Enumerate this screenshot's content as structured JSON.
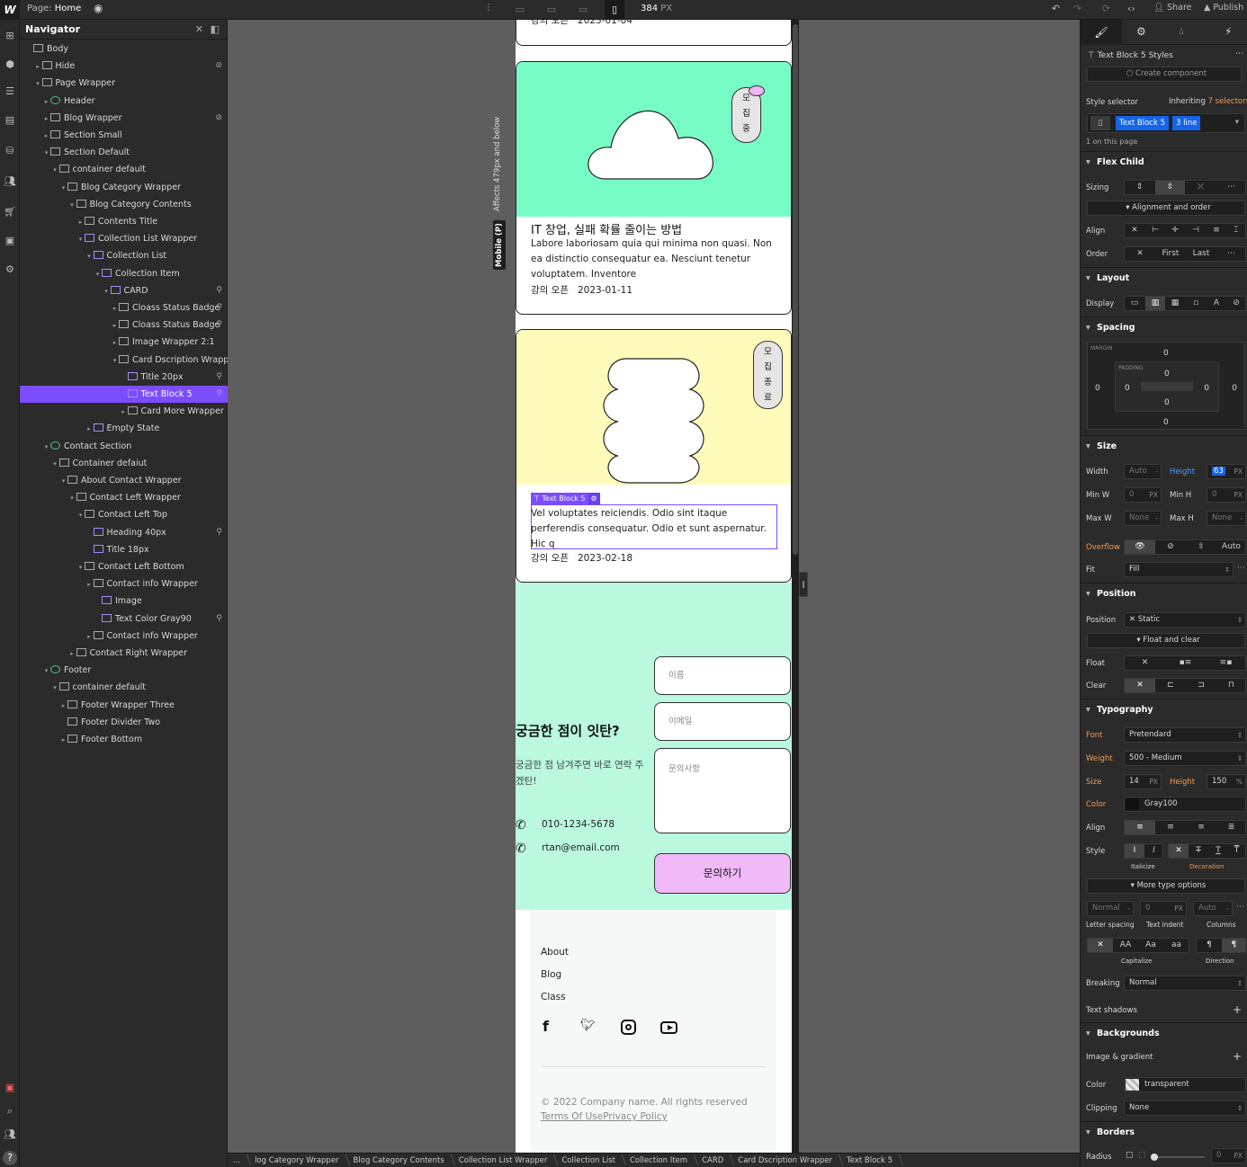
{
  "topbar": {
    "page_label": "Page:",
    "page_name": "Home",
    "width_value": "384",
    "width_unit": "PX",
    "share_label": "Share",
    "publish_label": "Publish"
  },
  "navigator": {
    "title": "Navigator",
    "items": [
      {
        "label": "Body",
        "depth": 0
      },
      {
        "label": "Hide",
        "depth": 1
      },
      {
        "label": "Page Wrapper",
        "depth": 1
      },
      {
        "label": "Header",
        "depth": 2
      },
      {
        "label": "Blog Wrapper",
        "depth": 2
      },
      {
        "label": "Section Small",
        "depth": 2
      },
      {
        "label": "Section Default",
        "depth": 2
      },
      {
        "label": "container default",
        "depth": 3
      },
      {
        "label": "Blog Category Wrapper",
        "depth": 4
      },
      {
        "label": "Blog Category Contents",
        "depth": 5
      },
      {
        "label": "Contents Title",
        "depth": 6
      },
      {
        "label": "Collection List Wrapper",
        "depth": 6
      },
      {
        "label": "Collection List",
        "depth": 7
      },
      {
        "label": "Collection Item",
        "depth": 8
      },
      {
        "label": "CARD",
        "depth": 9
      },
      {
        "label": "Cloass Status Badge",
        "depth": 10
      },
      {
        "label": "Cloass Status Badge",
        "depth": 10
      },
      {
        "label": "Image Wrapper 2:1",
        "depth": 10
      },
      {
        "label": "Card Dscription Wrapper",
        "depth": 10
      },
      {
        "label": "Title 20px",
        "depth": 11
      },
      {
        "label": "Text Block 5",
        "depth": 11
      },
      {
        "label": "Card More Wrapper",
        "depth": 11
      },
      {
        "label": "Empty State",
        "depth": 7
      },
      {
        "label": "Contact Section",
        "depth": 2
      },
      {
        "label": "Container defaiut",
        "depth": 3
      },
      {
        "label": "About Contact Wrapper",
        "depth": 4
      },
      {
        "label": "Contact Left Wrapper",
        "depth": 5
      },
      {
        "label": "Contact Left Top",
        "depth": 6
      },
      {
        "label": "Heading 40px",
        "depth": 7
      },
      {
        "label": "Title 18px",
        "depth": 7
      },
      {
        "label": "Contact Left Bottom",
        "depth": 6
      },
      {
        "label": "Contact info Wrapper",
        "depth": 7
      },
      {
        "label": "Image",
        "depth": 8
      },
      {
        "label": "Text Color Gray90",
        "depth": 8
      },
      {
        "label": "Contact info Wrapper",
        "depth": 7
      },
      {
        "label": "Contact Right Wrapper",
        "depth": 5
      },
      {
        "label": "Footer",
        "depth": 2
      },
      {
        "label": "container default",
        "depth": 3
      },
      {
        "label": "Footer Wrapper Three",
        "depth": 4
      },
      {
        "label": "Footer Divider Two",
        "depth": 4
      },
      {
        "label": "Footer Bottom",
        "depth": 4
      }
    ]
  },
  "canvas": {
    "affects_label": "Affects 479px and below",
    "breakpoint_label": "Mobile (P)",
    "top_meta": "강의 오픈   2023-01-04",
    "cards": [
      {
        "badge": "모\n집\n중",
        "title": "IT 창업, 실패 확률 줄이는 방법",
        "desc": "Labore laboriosam quia qui minima non quasi. Non ea distinctio consequatur ea. Nesciunt tenetur voluptatem. Inventore",
        "meta": "강의 오픈   2023-01-11",
        "color": "#78fcc5"
      },
      {
        "badge": "모\n집\n종\n료",
        "title": "",
        "desc": "Vel voluptates reiciendis. Odio sint itaque perferendis consequatur. Odio et sunt aspernatur. Hic q",
        "meta": "강의 오픈   2023-02-18",
        "color": "#fffcbb"
      }
    ],
    "selection_tag": "Text Block 5",
    "contact": {
      "heading": "궁금한 점이 잇탄?",
      "sub": "궁금한 점 남겨주면 바로 연락 주겠탄!",
      "phone": "010-1234-5678",
      "email": "rtan@email.com",
      "name_placeholder": "이름",
      "email_placeholder": "이메일",
      "message_placeholder": "문의사항",
      "submit": "문의하기"
    },
    "footer": {
      "links": [
        "About",
        "Blog",
        "Class"
      ],
      "copyright": "© 2022 Company name. All rights reserved",
      "terms": "Terms Of Use",
      "privacy": "Privacy Policy"
    }
  },
  "breadcrumb": [
    "...",
    "log Category Wrapper",
    "Blog Category Contents",
    "Collection List Wrapper",
    "Collection List",
    "Collection Item",
    "CARD",
    "Card Dscription Wrapper",
    "Text Block 5"
  ],
  "style_panel": {
    "element_title": "Text Block 5 Styles",
    "create_component": "Create component",
    "style_selector": "Style selector",
    "inheriting": "Inheriting",
    "inheriting_count": "7 selectors",
    "class1": "Text Block 5",
    "class2": "3 line",
    "on_page": "1 on this page",
    "flex_child": "Flex Child",
    "sizing": "Sizing",
    "alignment_order": "Alignment and order",
    "align": "Align",
    "order": "Order",
    "order_first": "First",
    "order_last": "Last",
    "layout": "Layout",
    "display": "Display",
    "spacing": "Spacing",
    "margin_label": "MARGIN",
    "padding_label": "PADDING",
    "margin": {
      "top": "0",
      "right": "0",
      "bottom": "0",
      "left": "0"
    },
    "padding": {
      "top": "0",
      "right": "0",
      "bottom": "0",
      "left": "0"
    },
    "size": "Size",
    "width": "Width",
    "width_val": "Auto",
    "height": "Height",
    "height_val": "63",
    "unit_px": "PX",
    "min_w": "Min W",
    "min_w_val": "0",
    "min_h": "Min H",
    "min_h_val": "0",
    "max_w": "Max W",
    "max_w_val": "None",
    "max_h": "Max H",
    "max_h_val": "None",
    "overflow": "Overflow",
    "overflow_auto": "Auto",
    "fit": "Fit",
    "fit_val": "Fill",
    "position_sec": "Position",
    "position": "Position",
    "position_val": "Static",
    "float_clear": "Float and clear",
    "float": "Float",
    "clear": "Clear",
    "typography": "Typography",
    "font": "Font",
    "font_val": "Pretendard",
    "weight": "Weight",
    "weight_val": "500 - Medium",
    "size_lbl": "Size",
    "size_val": "14",
    "line_height": "Height",
    "line_height_val": "150",
    "line_height_unit": "%",
    "color": "Color",
    "color_val": "Gray100",
    "t_align": "Align",
    "style": "Style",
    "italicize": "Italicize",
    "decoration": "Decoration",
    "more_type": "More type options",
    "letter_val": "Normal",
    "indent_val": "0",
    "columns_val": "Auto",
    "letter_spacing": "Letter spacing",
    "text_indent": "Text indent",
    "columns": "Columns",
    "capitalize": "Capitalize",
    "direction": "Direction",
    "breaking": "Breaking",
    "breaking_val": "Normal",
    "text_shadows": "Text shadows",
    "backgrounds": "Backgrounds",
    "image_gradient": "Image & gradient",
    "bg_color": "Color",
    "bg_color_val": "transparent",
    "clipping": "Clipping",
    "clipping_val": "None",
    "borders": "Borders",
    "radius": "Radius",
    "radius_val": "0"
  },
  "colors": {
    "accent": "#7c4dff",
    "panel": "#2b2b2b",
    "blue": "#1565e8",
    "orange": "#f19c53"
  }
}
